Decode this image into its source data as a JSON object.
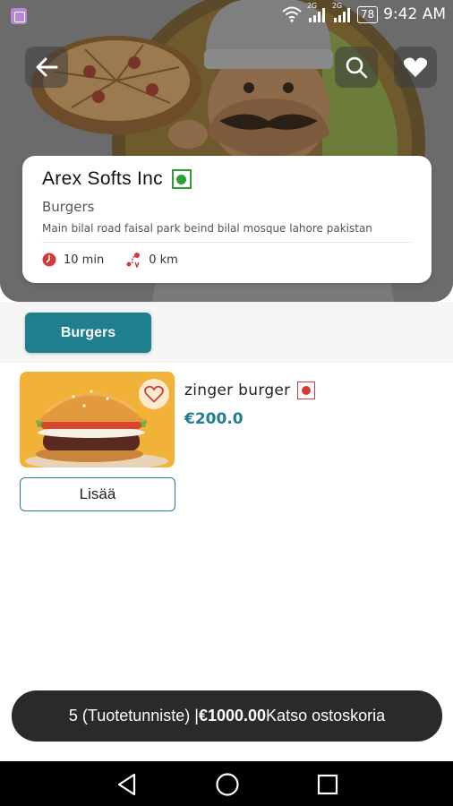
{
  "status_bar": {
    "network_1": "2G",
    "network_2": "2G",
    "battery": "78",
    "time": "9:42 AM"
  },
  "header": {
    "back_icon": "arrow-left-icon",
    "search_icon": "search-icon",
    "favorites_icon": "heart-icon"
  },
  "restaurant": {
    "name": "Arex Softs Inc",
    "category": "Burgers",
    "address": "Main bilal road faisal park beind bilal mosque lahore pakistan",
    "delivery_time": "10 min",
    "distance": "0 km",
    "veg_indicator_color": "#2e9e34"
  },
  "categories": {
    "selected": "Burgers"
  },
  "products": [
    {
      "name": "zinger burger",
      "price": "€200.0",
      "add_label": "Lisää",
      "nonveg_indicator_color": "#d23a3a"
    }
  ],
  "cart": {
    "count_text": "5 (Tuotetunniste) |",
    "total": "€1000.00",
    "action_label": "Katso ostoskoria"
  },
  "colors": {
    "accent": "#1f7f8f",
    "cart_bar": "#2a2a2a"
  }
}
